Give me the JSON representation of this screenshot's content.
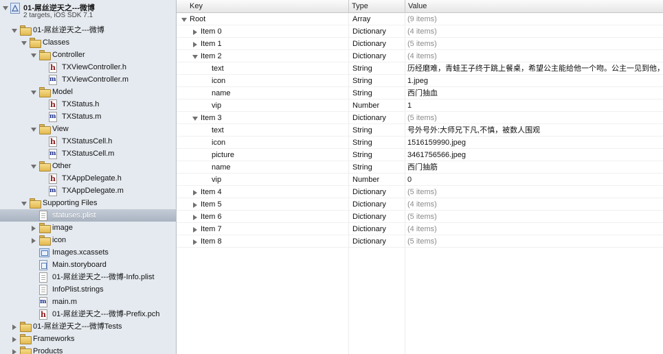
{
  "project": {
    "name": "01-屌丝逆天之---微博",
    "subtitle": "2 targets, iOS SDK 7.1"
  },
  "navigator": {
    "items": [
      {
        "label": "01-屌丝逆天之---微博",
        "icon": "folder-icon",
        "indent": 1,
        "disclosure": "open"
      },
      {
        "label": "Classes",
        "icon": "folder-icon",
        "indent": 2,
        "disclosure": "open"
      },
      {
        "label": "Controller",
        "icon": "folder-icon",
        "indent": 3,
        "disclosure": "open"
      },
      {
        "label": "TXViewController.h",
        "icon": "header-file-icon",
        "indent": 4,
        "disclosure": "none"
      },
      {
        "label": "TXViewController.m",
        "icon": "impl-file-icon",
        "indent": 4,
        "disclosure": "none"
      },
      {
        "label": "Model",
        "icon": "folder-icon",
        "indent": 3,
        "disclosure": "open"
      },
      {
        "label": "TXStatus.h",
        "icon": "header-file-icon",
        "indent": 4,
        "disclosure": "none"
      },
      {
        "label": "TXStatus.m",
        "icon": "impl-file-icon",
        "indent": 4,
        "disclosure": "none"
      },
      {
        "label": "View",
        "icon": "folder-icon",
        "indent": 3,
        "disclosure": "open"
      },
      {
        "label": "TXStatusCell.h",
        "icon": "header-file-icon",
        "indent": 4,
        "disclosure": "none"
      },
      {
        "label": "TXStatusCell.m",
        "icon": "impl-file-icon",
        "indent": 4,
        "disclosure": "none"
      },
      {
        "label": "Other",
        "icon": "folder-icon",
        "indent": 3,
        "disclosure": "open"
      },
      {
        "label": "TXAppDelegate.h",
        "icon": "header-file-icon",
        "indent": 4,
        "disclosure": "none"
      },
      {
        "label": "TXAppDelegate.m",
        "icon": "impl-file-icon",
        "indent": 4,
        "disclosure": "none"
      },
      {
        "label": "Supporting Files",
        "icon": "folder-icon",
        "indent": 2,
        "disclosure": "open"
      },
      {
        "label": "statuses.plist",
        "icon": "plist-icon",
        "indent": 3,
        "disclosure": "none",
        "selected": true
      },
      {
        "label": "image",
        "icon": "folder-icon",
        "indent": 3,
        "disclosure": "closed"
      },
      {
        "label": "icon",
        "icon": "folder-icon",
        "indent": 3,
        "disclosure": "closed"
      },
      {
        "label": "Images.xcassets",
        "icon": "assets-icon",
        "indent": 3,
        "disclosure": "none"
      },
      {
        "label": "Main.storyboard",
        "icon": "storyboard-icon",
        "indent": 3,
        "disclosure": "none"
      },
      {
        "label": "01-屌丝逆天之---微博-Info.plist",
        "icon": "plist-icon",
        "indent": 3,
        "disclosure": "none"
      },
      {
        "label": "InfoPlist.strings",
        "icon": "doc-icon",
        "indent": 3,
        "disclosure": "none"
      },
      {
        "label": "main.m",
        "icon": "impl-file-icon",
        "indent": 3,
        "disclosure": "none"
      },
      {
        "label": "01-屌丝逆天之---微博-Prefix.pch",
        "icon": "header-file-icon",
        "indent": 3,
        "disclosure": "none"
      },
      {
        "label": "01-屌丝逆天之---微博Tests",
        "icon": "folder-icon",
        "indent": 1,
        "disclosure": "closed"
      },
      {
        "label": "Frameworks",
        "icon": "folder-icon",
        "indent": 1,
        "disclosure": "closed"
      },
      {
        "label": "Products",
        "icon": "folder-icon",
        "indent": 1,
        "disclosure": "closed"
      }
    ]
  },
  "plist": {
    "columns": {
      "key": "Key",
      "type": "Type",
      "value": "Value"
    },
    "rows": [
      {
        "key": "Root",
        "type": "Array",
        "value": "(9 items)",
        "level": 0,
        "disclosure": "open",
        "count": true
      },
      {
        "key": "Item 0",
        "type": "Dictionary",
        "value": "(4 items)",
        "level": 1,
        "disclosure": "closed",
        "count": true
      },
      {
        "key": "Item 1",
        "type": "Dictionary",
        "value": "(5 items)",
        "level": 1,
        "disclosure": "closed",
        "count": true
      },
      {
        "key": "Item 2",
        "type": "Dictionary",
        "value": "(4 items)",
        "level": 1,
        "disclosure": "open",
        "count": true
      },
      {
        "key": "text",
        "type": "String",
        "value": "历经磨难，青蛙王子终于跳上餐桌，希望公主能给他一个吻。公主一见到他，",
        "level": 2,
        "disclosure": "none"
      },
      {
        "key": "icon",
        "type": "String",
        "value": "1.jpeg",
        "level": 2,
        "disclosure": "none"
      },
      {
        "key": "name",
        "type": "String",
        "value": "西门抽血",
        "level": 2,
        "disclosure": "none"
      },
      {
        "key": "vip",
        "type": "Number",
        "value": "1",
        "level": 2,
        "disclosure": "none"
      },
      {
        "key": "Item 3",
        "type": "Dictionary",
        "value": "(5 items)",
        "level": 1,
        "disclosure": "open",
        "count": true
      },
      {
        "key": "text",
        "type": "String",
        "value": "号外号外:大师兄下凡,不慎，被数人围观",
        "level": 2,
        "disclosure": "none"
      },
      {
        "key": "icon",
        "type": "String",
        "value": "1516159990.jpeg",
        "level": 2,
        "disclosure": "none"
      },
      {
        "key": "picture",
        "type": "String",
        "value": "3461756566.jpeg",
        "level": 2,
        "disclosure": "none"
      },
      {
        "key": "name",
        "type": "String",
        "value": "西门抽筋",
        "level": 2,
        "disclosure": "none"
      },
      {
        "key": "vip",
        "type": "Number",
        "value": "0",
        "level": 2,
        "disclosure": "none"
      },
      {
        "key": "Item 4",
        "type": "Dictionary",
        "value": "(5 items)",
        "level": 1,
        "disclosure": "closed",
        "count": true
      },
      {
        "key": "Item 5",
        "type": "Dictionary",
        "value": "(4 items)",
        "level": 1,
        "disclosure": "closed",
        "count": true
      },
      {
        "key": "Item 6",
        "type": "Dictionary",
        "value": "(5 items)",
        "level": 1,
        "disclosure": "closed",
        "count": true
      },
      {
        "key": "Item 7",
        "type": "Dictionary",
        "value": "(4 items)",
        "level": 1,
        "disclosure": "closed",
        "count": true
      },
      {
        "key": "Item 8",
        "type": "Dictionary",
        "value": "(5 items)",
        "level": 1,
        "disclosure": "closed",
        "count": true
      }
    ]
  }
}
